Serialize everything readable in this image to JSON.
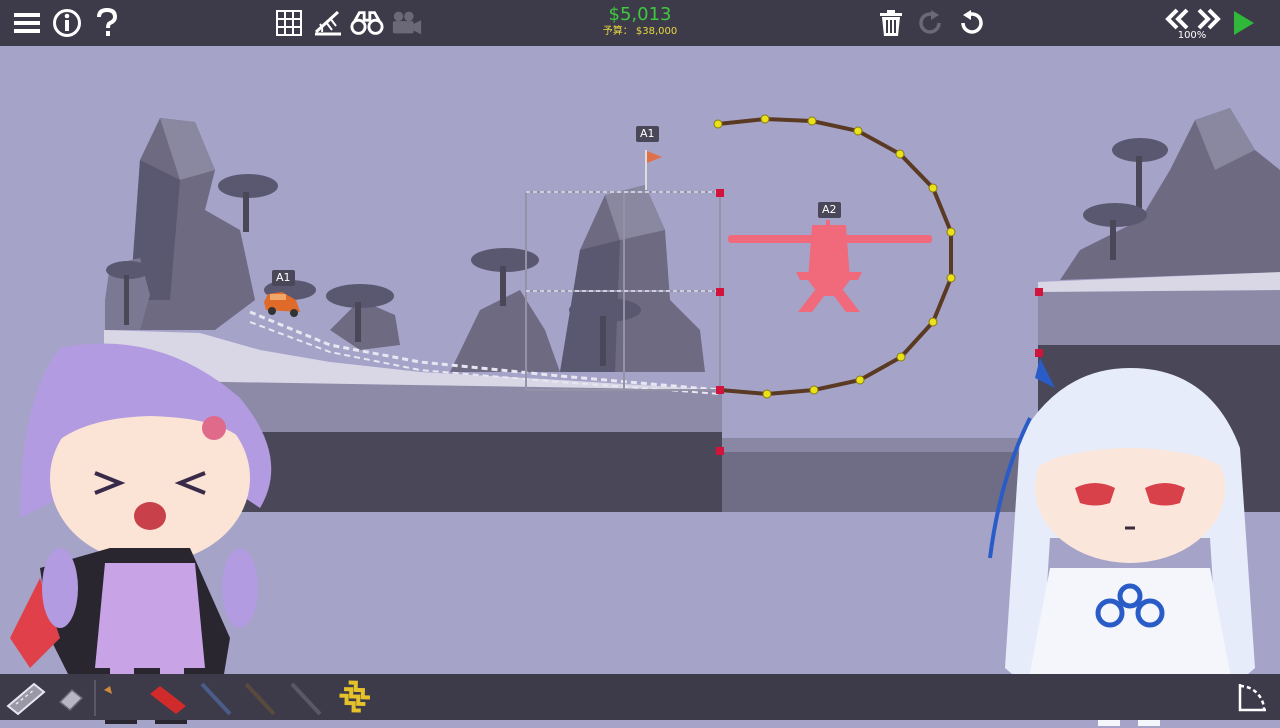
{
  "hud": {
    "cost": "$5,013",
    "budget": "予算： $38,000",
    "speed": "100%"
  },
  "toolbar_icons": [
    "menu-icon",
    "info-icon",
    "help-icon",
    "grid-icon",
    "stress-icon",
    "binoculars-icon",
    "camera-icon",
    "trash-icon",
    "redo-icon",
    "undo-icon",
    "rewind-icon",
    "fast-forward-icon",
    "play-icon"
  ],
  "scene": {
    "vehicle_tag": "A1",
    "flag_tag": "A1",
    "plane_tag": "A2"
  },
  "materials": [
    "road-tool",
    "eraser-tool",
    "wood-tool",
    "steel-tool",
    "cable-tool",
    "rope-tool",
    "spring-tool"
  ],
  "colors": {
    "bar": "#3d3b4a",
    "sky": "#a6a3c9",
    "cost": "#3ec93e",
    "budget": "#e9d640",
    "play": "#2fb83a",
    "plane": "#f06a7c",
    "rope": "#5a3a22",
    "node": "#e9e21a",
    "anchor": "#d0143c"
  }
}
